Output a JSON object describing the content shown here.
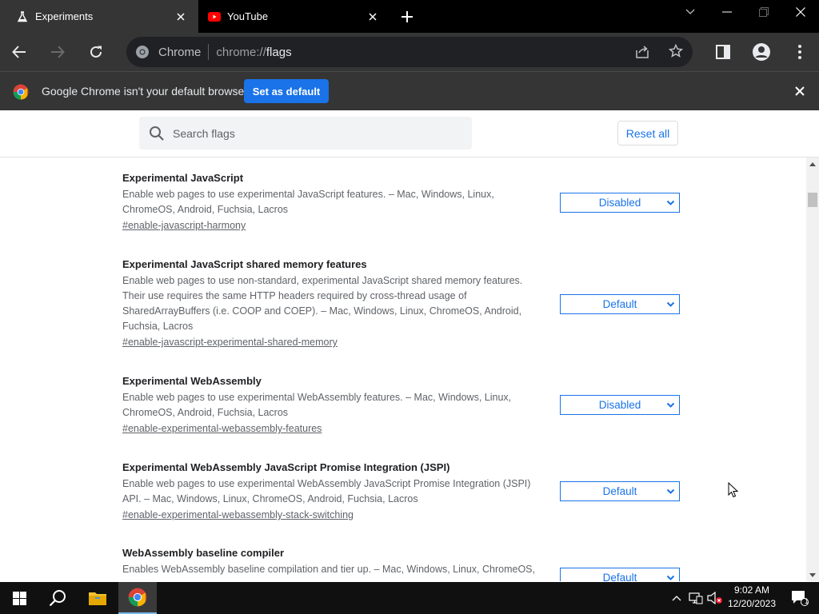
{
  "tabs": [
    {
      "title": "Experiments",
      "icon": "flask-icon"
    },
    {
      "title": "YouTube",
      "icon": "youtube-icon"
    }
  ],
  "toolbar": {
    "site_chip": "Chrome",
    "url_prefix": "chrome://",
    "url_host": "flags"
  },
  "infobar": {
    "message": "Google Chrome isn't your default browser",
    "button_label": "Set as default"
  },
  "flags_header": {
    "search_placeholder": "Search flags",
    "reset_label": "Reset all"
  },
  "flags": [
    {
      "title": "Experimental JavaScript",
      "description": "Enable web pages to use experimental JavaScript features. – Mac, Windows, Linux, ChromeOS, Android, Fuchsia, Lacros",
      "link": "#enable-javascript-harmony",
      "value": "Disabled"
    },
    {
      "title": "Experimental JavaScript shared memory features",
      "description": "Enable web pages to use non-standard, experimental JavaScript shared memory features. Their use requires the same HTTP headers required by cross-thread usage of SharedArrayBuffers (i.e. COOP and COEP). – Mac, Windows, Linux, ChromeOS, Android, Fuchsia, Lacros",
      "link": "#enable-javascript-experimental-shared-memory",
      "value": "Default"
    },
    {
      "title": "Experimental WebAssembly",
      "description": "Enable web pages to use experimental WebAssembly features. – Mac, Windows, Linux, ChromeOS, Android, Fuchsia, Lacros",
      "link": "#enable-experimental-webassembly-features",
      "value": "Disabled"
    },
    {
      "title": "Experimental WebAssembly JavaScript Promise Integration (JSPI)",
      "description": "Enable web pages to use experimental WebAssembly JavaScript Promise Integration (JSPI) API. – Mac, Windows, Linux, ChromeOS, Android, Fuchsia, Lacros",
      "link": "#enable-experimental-webassembly-stack-switching",
      "value": "Default"
    },
    {
      "title": "WebAssembly baseline compiler",
      "description": "Enables WebAssembly baseline compilation and tier up. – Mac, Windows, Linux, ChromeOS,",
      "link": "",
      "value": "Default"
    }
  ],
  "taskbar": {
    "time": "9:02 AM",
    "date": "12/20/2023",
    "notification_count": "1"
  },
  "colors": {
    "accent": "#1a73e8",
    "chrome_dark": "#353535",
    "tabstrip": "#000000"
  }
}
